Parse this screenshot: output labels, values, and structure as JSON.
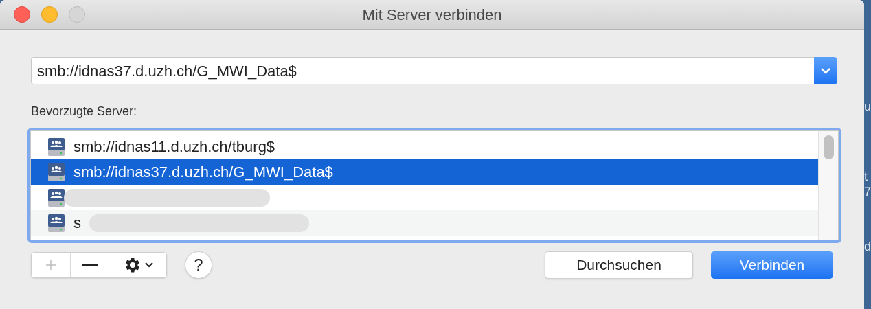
{
  "window": {
    "title": "Mit Server verbinden"
  },
  "address": {
    "value": "smb://idnas37.d.uzh.ch/G_MWI_Data$"
  },
  "favorites_label": "Bevorzugte Server:",
  "servers": [
    {
      "text": "smb://idnas11.d.uzh.ch/tburg$",
      "selected": false,
      "redacted": false
    },
    {
      "text": "smb://idnas37.d.uzh.ch/G_MWI_Data$",
      "selected": true,
      "redacted": false
    },
    {
      "selected": false,
      "redacted": true
    },
    {
      "text": "s",
      "selected": false,
      "redacted": true
    }
  ],
  "list_buttons": [
    {
      "kind": "add",
      "disabled": true
    },
    {
      "kind": "remove",
      "disabled": false
    },
    {
      "kind": "actions",
      "disabled": false
    }
  ],
  "help": "?",
  "buttons": [
    {
      "label": "Durchsuchen",
      "default": false
    },
    {
      "label": "Verbinden",
      "default": true
    }
  ],
  "desktop_fragments": [
    "u",
    "t",
    "7",
    "d"
  ]
}
